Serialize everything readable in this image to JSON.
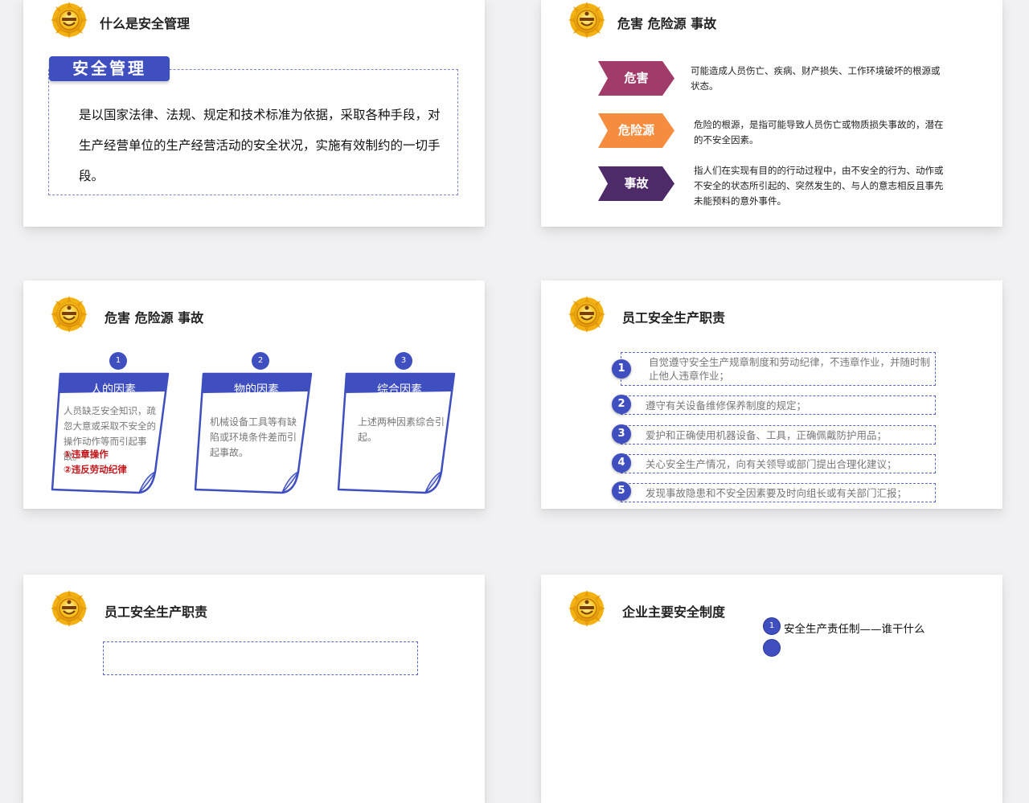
{
  "colors": {
    "accent_blue": "#3f4fbf",
    "hazard": "#a03b6a",
    "hazard_source": "#f58c3e",
    "accident": "#4f2a68",
    "warning_red": "#c0161b"
  },
  "slides": [
    {
      "title": "什么是安全管理",
      "tag": "安全管理",
      "body": "是以国家法律、法规、规定和技术标准为依据，采取各种手段，对生产经营单位的生产经营活动的安全状况，实施有效制约的一切手段。"
    },
    {
      "title": "危害 危险源 事故",
      "items": [
        {
          "label": "危害",
          "desc": "可能造成人员伤亡、疾病、财产损失、工作环境破坏的根源或状态。"
        },
        {
          "label": "危险源",
          "desc": "危险的根源，是指可能导致人员伤亡或物质损失事故的，潜在的不安全因素。"
        },
        {
          "label": "事故",
          "desc": "指人们在实现有目的的行动过程中，由不安全的行为、动作或不安全的状态所引起的、突然发生的、与人的意志相反且事先未能预料的意外事件。"
        }
      ]
    },
    {
      "title": "危害 危险源 事故",
      "notes": [
        {
          "num": "1",
          "title": "人的因素",
          "body": "人员缺乏安全知识，疏忽大意或采取不安全的操作动作等而引起事故。",
          "extra": [
            "①违章操作",
            "②违反劳动纪律"
          ]
        },
        {
          "num": "2",
          "title": "物的因素",
          "body": "机械设备工具等有缺陷或环境条件差而引起事故。"
        },
        {
          "num": "3",
          "title": "综合因素",
          "body": "上述两种因素综合引起。"
        }
      ]
    },
    {
      "title": "员工安全生产职责",
      "duties": [
        {
          "num": "1",
          "text": "自觉遵守安全生产规章制度和劳动纪律，不违章作业，并随时制止他人违章作业；"
        },
        {
          "num": "2",
          "text": "遵守有关设备维修保养制度的规定；"
        },
        {
          "num": "3",
          "text": "爱护和正确使用机器设备、工具，正确佩戴防护用品；"
        },
        {
          "num": "4",
          "text": "关心安全生产情况，向有关领导或部门提出合理化建议；"
        },
        {
          "num": "5",
          "text": "发现事故隐患和不安全因素要及时向组长或有关部门汇报；"
        }
      ]
    },
    {
      "title": "员工安全生产职责"
    },
    {
      "title": "企业主要安全制度",
      "systems": [
        {
          "num": "1",
          "text": "安全生产责任制——谁干什么"
        }
      ]
    }
  ]
}
